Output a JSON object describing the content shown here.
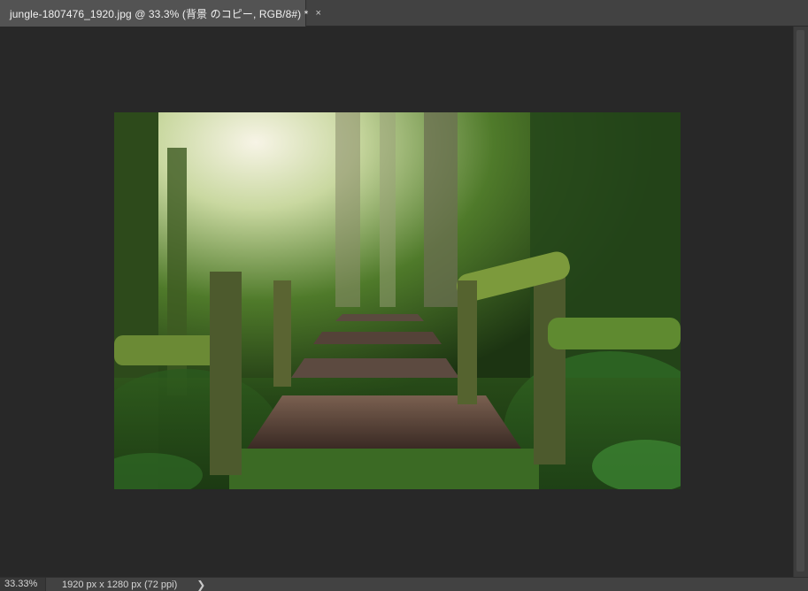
{
  "tab": {
    "title": "jungle-1807476_1920.jpg @ 33.3% (背景 のコピー, RGB/8#) *",
    "close_glyph": "×"
  },
  "status": {
    "zoom": "33.33%",
    "doc_info": "1920 px x 1280 px (72 ppi)",
    "arrow_glyph": "❯"
  },
  "colors": {
    "panel_bg": "#535353",
    "canvas_bg": "#282828",
    "tabbar_bg": "#424242"
  },
  "icons": {
    "tab_close": "close-icon",
    "status_menu": "chevron-right-icon"
  }
}
